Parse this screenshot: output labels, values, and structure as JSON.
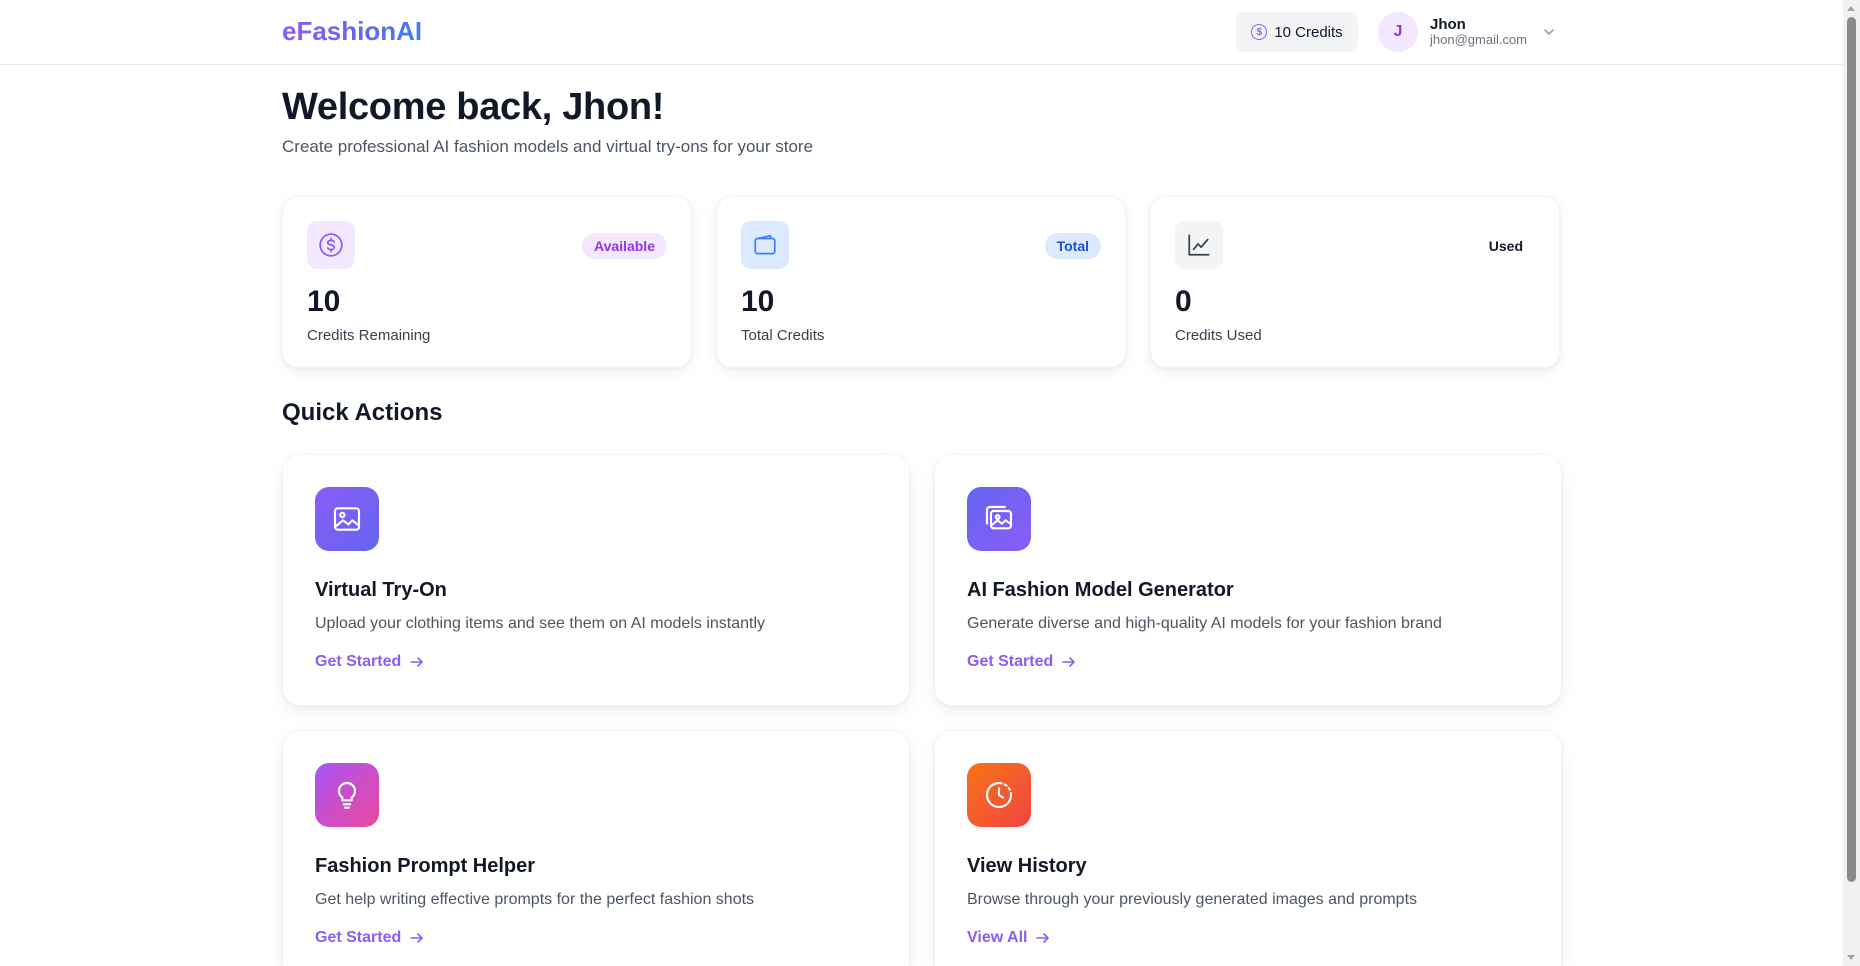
{
  "app": {
    "logo": "eFashionAI"
  },
  "header": {
    "credits_label": "10 Credits",
    "user": {
      "initial": "J",
      "name": "Jhon",
      "email": "jhon@gmail.com"
    }
  },
  "welcome": {
    "title": "Welcome back, Jhon!",
    "subtitle": "Create professional AI fashion models and virtual try-ons for your store"
  },
  "stats": [
    {
      "value": "10",
      "label": "Credits Remaining",
      "badge": "Available",
      "icon": "coin-icon"
    },
    {
      "value": "10",
      "label": "Total Credits",
      "badge": "Total",
      "icon": "wallet-icon"
    },
    {
      "value": "0",
      "label": "Credits Used",
      "badge": "Used",
      "icon": "chart-line-icon"
    }
  ],
  "quick_actions": {
    "title": "Quick Actions",
    "items": [
      {
        "title": "Virtual Try-On",
        "description": "Upload your clothing items and see them on AI models instantly",
        "link": "Get Started",
        "icon": "image-icon"
      },
      {
        "title": "AI Fashion Model Generator",
        "description": "Generate diverse and high-quality AI models for your fashion brand",
        "link": "Get Started",
        "icon": "images-icon"
      },
      {
        "title": "Fashion Prompt Helper",
        "description": "Get help writing effective prompts for the perfect fashion shots",
        "link": "Get Started",
        "icon": "lightbulb-icon"
      },
      {
        "title": "View History",
        "description": "Browse through your previously generated images and prompts",
        "link": "View All",
        "icon": "history-icon"
      }
    ]
  },
  "colors": {
    "brand": "#8b5cf6",
    "purple_badge_bg": "#f3e8ff",
    "blue_badge_bg": "#dbeafe",
    "orange": "#f97316"
  }
}
